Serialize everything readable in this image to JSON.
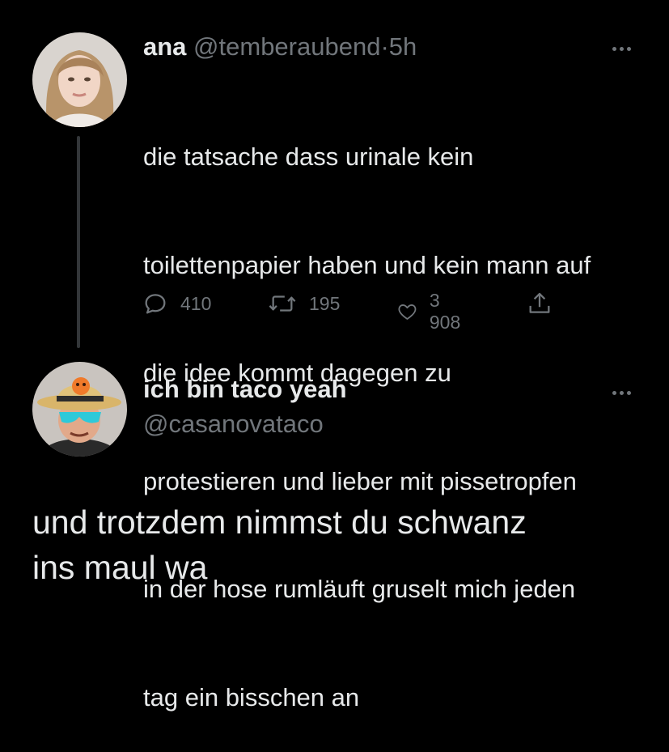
{
  "original_tweet": {
    "display_name": "ana",
    "handle": "@temberaubend",
    "separator": "·",
    "time": "5h",
    "text": "die tatsache dass urinale kein toilettenpapier haben und kein mann auf die idee kommt dagegen zu protestieren und lieber mit pissetropfen in der hose rumläuft gruselt mich jeden tag ein bisschen an",
    "text_lines": [
      "die tatsache dass urinale kein",
      "toilettenpapier haben und kein mann auf",
      "die idee kommt dagegen zu",
      "protestieren und lieber mit pissetropfen",
      "in der hose rumläuft gruselt mich jeden",
      "tag ein bisschen an"
    ],
    "stats": {
      "replies": "410",
      "retweets": "195",
      "likes": "3 908"
    }
  },
  "reply_tweet": {
    "display_name": "ich bin taco yeah",
    "handle": "@casanovataco",
    "text_lines": [
      "und trotzdem nimmst du schwanz",
      "ins maul wa"
    ]
  },
  "icons": {
    "reply": "reply-icon",
    "retweet": "retweet-icon",
    "like": "heart-icon",
    "share": "share-icon",
    "more": "more-icon"
  },
  "colors": {
    "background": "#000000",
    "text_primary": "#e7e9ea",
    "text_secondary": "#71767b",
    "thread_line": "#333639"
  }
}
